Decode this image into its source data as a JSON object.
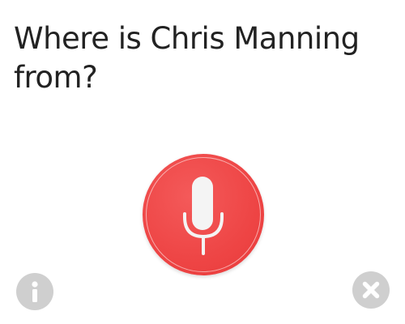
{
  "query": {
    "text": "Where is Chris Manning from?"
  },
  "mic_button": {
    "icon": "microphone-icon",
    "color": "#ee4545"
  },
  "info_button": {
    "icon": "info-icon",
    "color": "#cfcfcf"
  },
  "close_button": {
    "icon": "close-icon",
    "color": "#cfcfcf"
  }
}
